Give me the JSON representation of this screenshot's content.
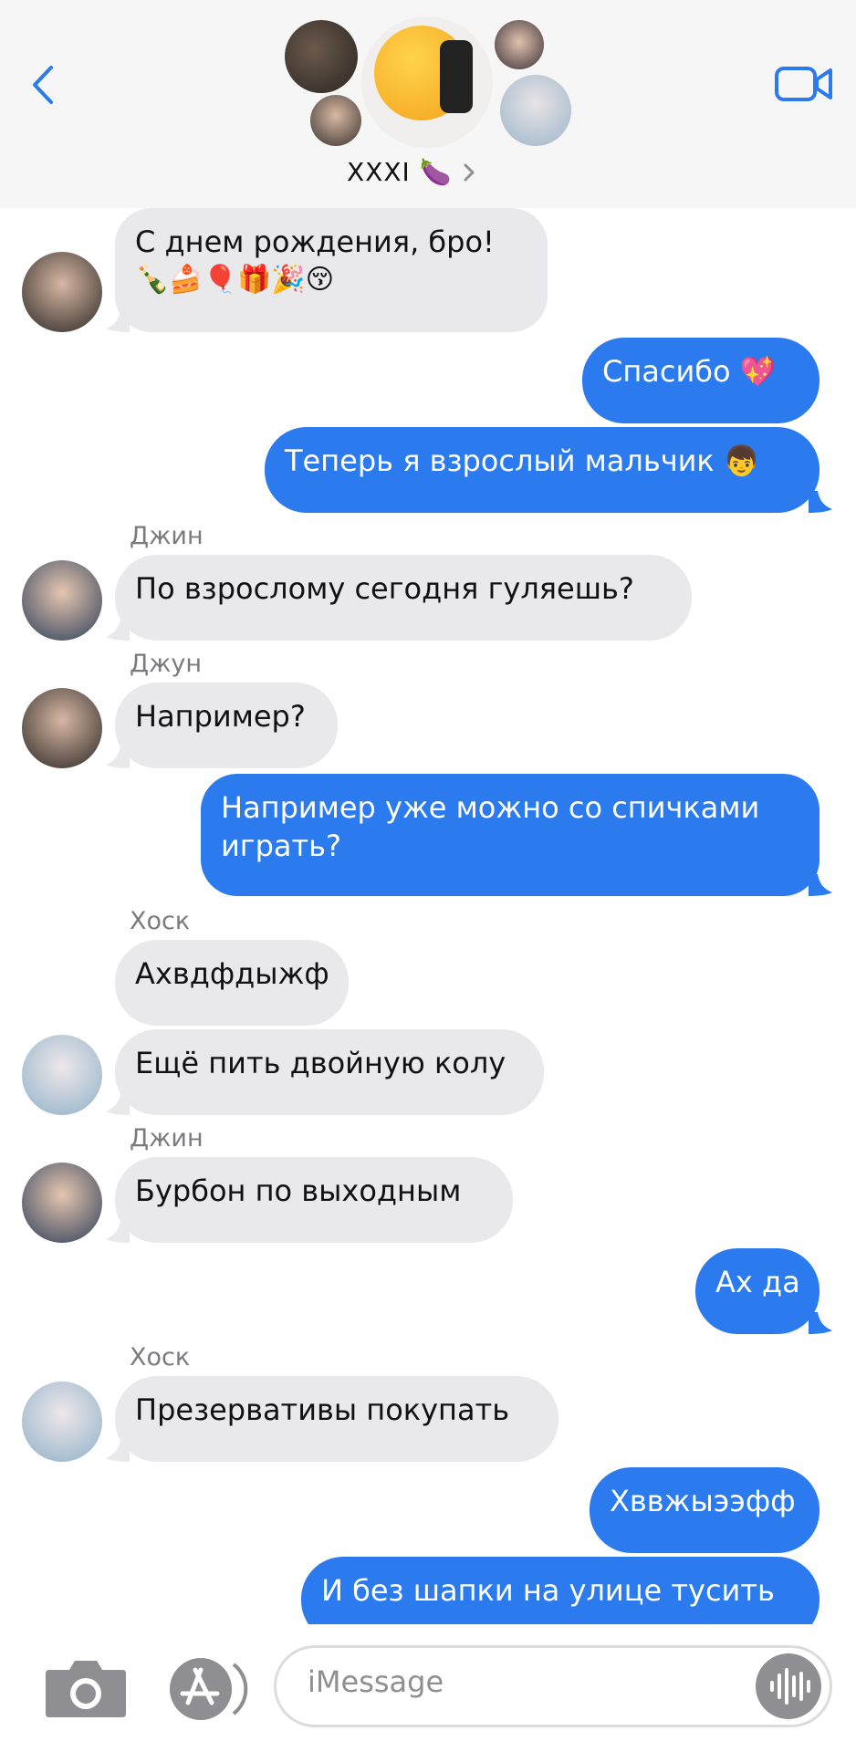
{
  "header": {
    "group_name": "XXXI 🍆",
    "back_icon": "chevron-left-icon",
    "video_icon": "video-camera-icon",
    "accent": "#2b7bef"
  },
  "messages": [
    {
      "dir": "in",
      "sender": "",
      "lines": [
        "С днем рождения,  бро!",
        "🍾🍰🎈🎁🎉😚"
      ]
    },
    {
      "dir": "out",
      "text": "Спасибо 💖"
    },
    {
      "dir": "out",
      "text": "Теперь я взрослый мальчик 👦"
    },
    {
      "dir": "in",
      "sender": "Джин",
      "text": "По взрослому сегодня гуляешь?"
    },
    {
      "dir": "in",
      "sender": "Джун",
      "text": "Например?"
    },
    {
      "dir": "out",
      "lines": [
        "Например уже можно со спичками",
        "играть?"
      ]
    },
    {
      "dir": "in",
      "sender": "Хоск",
      "text": "Ахвдфдыжф"
    },
    {
      "dir": "in",
      "sender": "",
      "text": "Ещё пить двойную колу"
    },
    {
      "dir": "in",
      "sender": "Джин",
      "text": "Бурбон по выходным"
    },
    {
      "dir": "out",
      "text": "Ах да"
    },
    {
      "dir": "in",
      "sender": "Хоск",
      "text": "Презервативы покупать"
    },
    {
      "dir": "out",
      "text": "Хввжыээфф"
    },
    {
      "dir": "out",
      "text": "И без шапки на улице тусить"
    }
  ],
  "compose": {
    "placeholder": "iMessage",
    "camera_icon": "camera-icon",
    "apps_icon": "app-store-icon",
    "mic_icon": "audio-waveform-icon"
  },
  "colors": {
    "incoming_bubble": "#e9e9eb",
    "outgoing_bubble": "#2b7bef"
  }
}
